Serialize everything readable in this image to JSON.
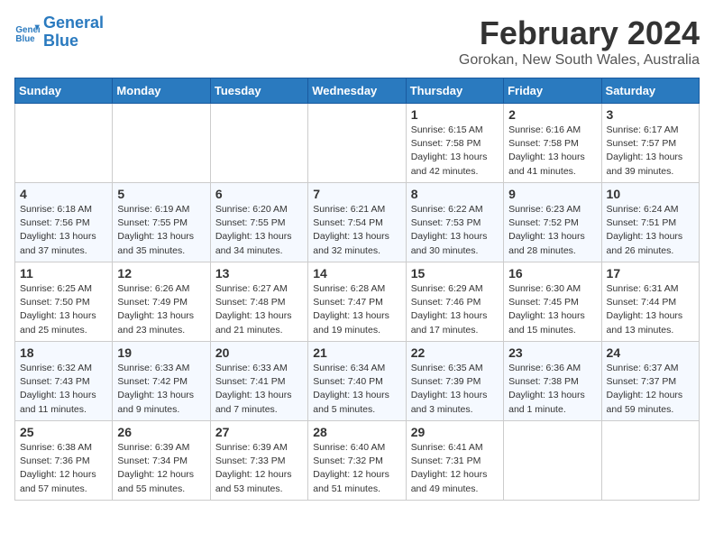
{
  "logo": {
    "line1": "General",
    "line2": "Blue"
  },
  "title": "February 2024",
  "subtitle": "Gorokan, New South Wales, Australia",
  "days_of_week": [
    "Sunday",
    "Monday",
    "Tuesday",
    "Wednesday",
    "Thursday",
    "Friday",
    "Saturday"
  ],
  "weeks": [
    [
      {
        "day": "",
        "info": ""
      },
      {
        "day": "",
        "info": ""
      },
      {
        "day": "",
        "info": ""
      },
      {
        "day": "",
        "info": ""
      },
      {
        "day": "1",
        "info": "Sunrise: 6:15 AM\nSunset: 7:58 PM\nDaylight: 13 hours\nand 42 minutes."
      },
      {
        "day": "2",
        "info": "Sunrise: 6:16 AM\nSunset: 7:58 PM\nDaylight: 13 hours\nand 41 minutes."
      },
      {
        "day": "3",
        "info": "Sunrise: 6:17 AM\nSunset: 7:57 PM\nDaylight: 13 hours\nand 39 minutes."
      }
    ],
    [
      {
        "day": "4",
        "info": "Sunrise: 6:18 AM\nSunset: 7:56 PM\nDaylight: 13 hours\nand 37 minutes."
      },
      {
        "day": "5",
        "info": "Sunrise: 6:19 AM\nSunset: 7:55 PM\nDaylight: 13 hours\nand 35 minutes."
      },
      {
        "day": "6",
        "info": "Sunrise: 6:20 AM\nSunset: 7:55 PM\nDaylight: 13 hours\nand 34 minutes."
      },
      {
        "day": "7",
        "info": "Sunrise: 6:21 AM\nSunset: 7:54 PM\nDaylight: 13 hours\nand 32 minutes."
      },
      {
        "day": "8",
        "info": "Sunrise: 6:22 AM\nSunset: 7:53 PM\nDaylight: 13 hours\nand 30 minutes."
      },
      {
        "day": "9",
        "info": "Sunrise: 6:23 AM\nSunset: 7:52 PM\nDaylight: 13 hours\nand 28 minutes."
      },
      {
        "day": "10",
        "info": "Sunrise: 6:24 AM\nSunset: 7:51 PM\nDaylight: 13 hours\nand 26 minutes."
      }
    ],
    [
      {
        "day": "11",
        "info": "Sunrise: 6:25 AM\nSunset: 7:50 PM\nDaylight: 13 hours\nand 25 minutes."
      },
      {
        "day": "12",
        "info": "Sunrise: 6:26 AM\nSunset: 7:49 PM\nDaylight: 13 hours\nand 23 minutes."
      },
      {
        "day": "13",
        "info": "Sunrise: 6:27 AM\nSunset: 7:48 PM\nDaylight: 13 hours\nand 21 minutes."
      },
      {
        "day": "14",
        "info": "Sunrise: 6:28 AM\nSunset: 7:47 PM\nDaylight: 13 hours\nand 19 minutes."
      },
      {
        "day": "15",
        "info": "Sunrise: 6:29 AM\nSunset: 7:46 PM\nDaylight: 13 hours\nand 17 minutes."
      },
      {
        "day": "16",
        "info": "Sunrise: 6:30 AM\nSunset: 7:45 PM\nDaylight: 13 hours\nand 15 minutes."
      },
      {
        "day": "17",
        "info": "Sunrise: 6:31 AM\nSunset: 7:44 PM\nDaylight: 13 hours\nand 13 minutes."
      }
    ],
    [
      {
        "day": "18",
        "info": "Sunrise: 6:32 AM\nSunset: 7:43 PM\nDaylight: 13 hours\nand 11 minutes."
      },
      {
        "day": "19",
        "info": "Sunrise: 6:33 AM\nSunset: 7:42 PM\nDaylight: 13 hours\nand 9 minutes."
      },
      {
        "day": "20",
        "info": "Sunrise: 6:33 AM\nSunset: 7:41 PM\nDaylight: 13 hours\nand 7 minutes."
      },
      {
        "day": "21",
        "info": "Sunrise: 6:34 AM\nSunset: 7:40 PM\nDaylight: 13 hours\nand 5 minutes."
      },
      {
        "day": "22",
        "info": "Sunrise: 6:35 AM\nSunset: 7:39 PM\nDaylight: 13 hours\nand 3 minutes."
      },
      {
        "day": "23",
        "info": "Sunrise: 6:36 AM\nSunset: 7:38 PM\nDaylight: 13 hours\nand 1 minute."
      },
      {
        "day": "24",
        "info": "Sunrise: 6:37 AM\nSunset: 7:37 PM\nDaylight: 12 hours\nand 59 minutes."
      }
    ],
    [
      {
        "day": "25",
        "info": "Sunrise: 6:38 AM\nSunset: 7:36 PM\nDaylight: 12 hours\nand 57 minutes."
      },
      {
        "day": "26",
        "info": "Sunrise: 6:39 AM\nSunset: 7:34 PM\nDaylight: 12 hours\nand 55 minutes."
      },
      {
        "day": "27",
        "info": "Sunrise: 6:39 AM\nSunset: 7:33 PM\nDaylight: 12 hours\nand 53 minutes."
      },
      {
        "day": "28",
        "info": "Sunrise: 6:40 AM\nSunset: 7:32 PM\nDaylight: 12 hours\nand 51 minutes."
      },
      {
        "day": "29",
        "info": "Sunrise: 6:41 AM\nSunset: 7:31 PM\nDaylight: 12 hours\nand 49 minutes."
      },
      {
        "day": "",
        "info": ""
      },
      {
        "day": "",
        "info": ""
      }
    ]
  ]
}
